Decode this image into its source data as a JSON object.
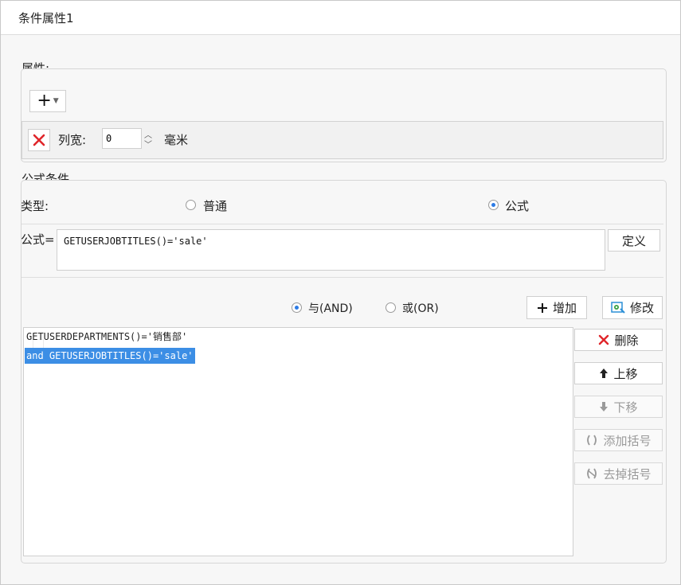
{
  "window": {
    "title": "条件属性1"
  },
  "attributes": {
    "label": "属性:",
    "add_button": "+",
    "row": {
      "label": "列宽:",
      "value": "0",
      "unit": "毫米"
    }
  },
  "formula_condition": {
    "label": "公式条件",
    "type_label": "类型:",
    "type_options": [
      {
        "label": "普通",
        "selected": false
      },
      {
        "label": "公式",
        "selected": true
      }
    ],
    "formula_label": "公式=",
    "formula_value": "GETUSERJOBTITLES()='sale'",
    "define_button": "定义"
  },
  "logic": {
    "options": [
      {
        "label": "与(AND)",
        "selected": true
      },
      {
        "label": "或(OR)",
        "selected": false
      }
    ],
    "add_button": "增加",
    "modify_button": "修改"
  },
  "conditions": [
    {
      "text": "GETUSERDEPARTMENTS()='销售部'",
      "selected": false
    },
    {
      "text": "and GETUSERJOBTITLES()='sale'",
      "selected": true
    }
  ],
  "side_buttons": {
    "delete": "删除",
    "move_up": "上移",
    "move_down": "下移",
    "add_bracket": "添加括号",
    "remove_bracket": "去掉括号"
  },
  "colors": {
    "selection": "#3c8ee5",
    "delete_red": "#e0262b",
    "radio_accent": "#2c7be5"
  }
}
